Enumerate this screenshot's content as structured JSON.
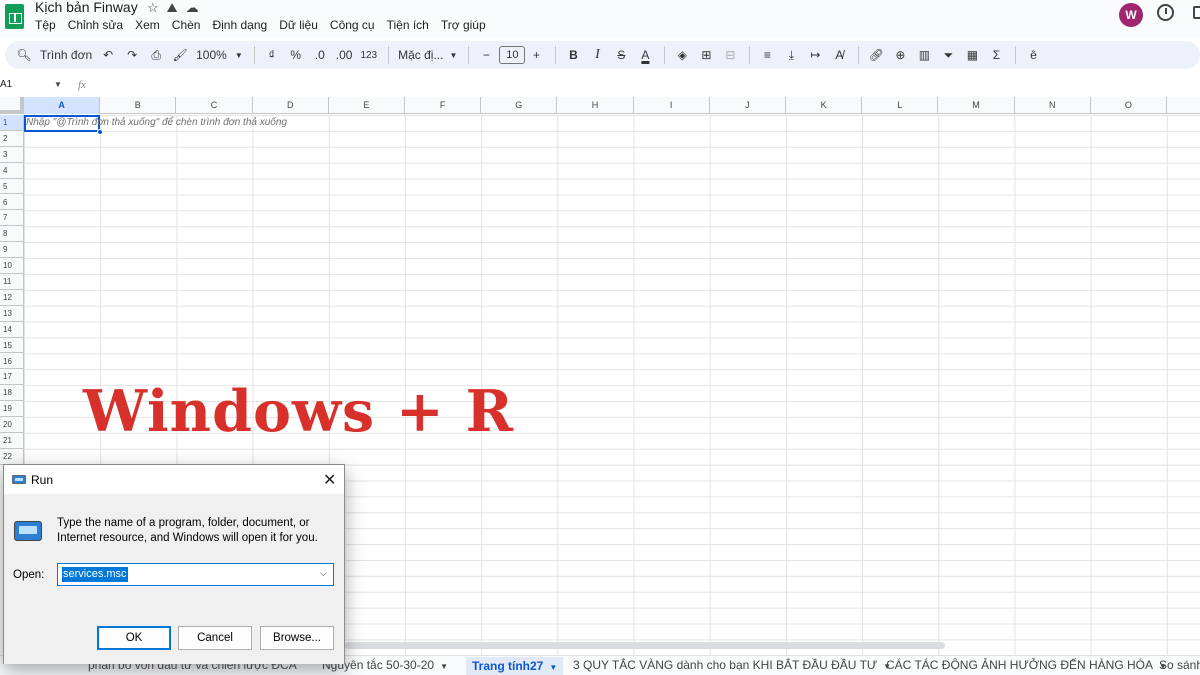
{
  "app": {
    "doc_title": "Kịch bản Finway",
    "menu": [
      "Tệp",
      "Chỉnh sửa",
      "Xem",
      "Chèn",
      "Định dạng",
      "Dữ liệu",
      "Công cụ",
      "Tiện ích",
      "Trợ giúp"
    ],
    "avatar_letter": "W"
  },
  "toolbar": {
    "search_label": "Trình đơn",
    "zoom": "100%",
    "currency": "₫",
    "percent": "%",
    "dec_decrease": ".0",
    "dec_increase": ".00",
    "number_format": "123",
    "font": "Mặc đị...",
    "font_size": "10"
  },
  "formula_bar": {
    "name_box": "A1",
    "fx": "fx"
  },
  "grid": {
    "columns": [
      "A",
      "B",
      "C",
      "D",
      "E",
      "F",
      "G",
      "H",
      "I",
      "J",
      "K",
      "L",
      "M",
      "N",
      "O"
    ],
    "rows": [
      "1",
      "2",
      "3",
      "4",
      "5",
      "6",
      "7",
      "8",
      "9",
      "10",
      "11",
      "12",
      "13",
      "14",
      "15",
      "16",
      "17",
      "18",
      "19",
      "20",
      "21",
      "22"
    ],
    "a1_hint": "Nhập \"@Trình đơn thả xuống\" để chèn trình đơn thả xuống"
  },
  "overlay_caption": "Windows + R",
  "sheet_tabs": [
    {
      "label": "phân bổ vốn đầu tư và chiến lược ĐCA",
      "active": false
    },
    {
      "label": "Nguyên tắc 50-30-20",
      "active": false
    },
    {
      "label": "Trang tính27",
      "active": true
    },
    {
      "label": "3 QUY TẮC VÀNG dành cho bạn KHI BẮT ĐẦU ĐẦU TƯ",
      "active": false
    },
    {
      "label": "CÁC TÁC ĐỘNG ẢNH HƯỞNG ĐẾN HÀNG HÓA",
      "active": false
    },
    {
      "label": "So sánh",
      "active": false
    }
  ],
  "run_dialog": {
    "title": "Run",
    "description": "Type the name of a program, folder, document, or Internet resource, and Windows will open it for you.",
    "open_label": "Open:",
    "input_value": "services.msc",
    "ok_label": "OK",
    "cancel_label": "Cancel",
    "browse_label": "Browse..."
  }
}
